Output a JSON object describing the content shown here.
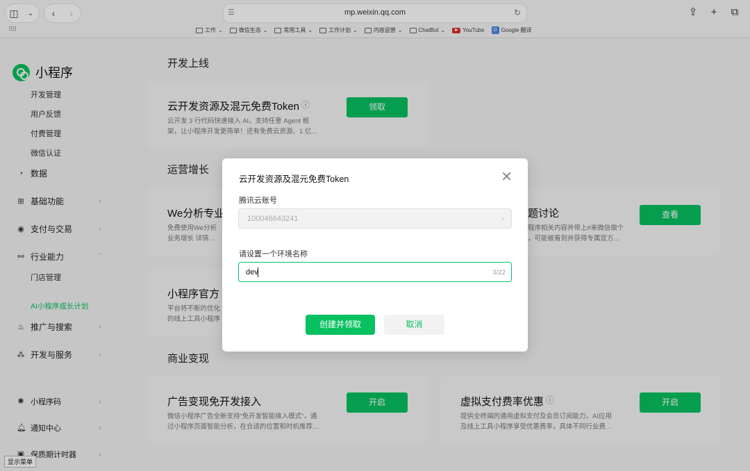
{
  "browser": {
    "url": "mp.weixin.qq.com",
    "bookmarks": [
      {
        "label": "工作"
      },
      {
        "label": "微信生态"
      },
      {
        "label": "常用工具"
      },
      {
        "label": "工作计划"
      },
      {
        "label": "内容运营"
      },
      {
        "label": "ChatBot"
      },
      {
        "label": "YouTube"
      },
      {
        "label": "Google 翻译"
      }
    ]
  },
  "sidebar": {
    "brand": "小程序",
    "sub_items_top": [
      "开发管理",
      "用户反馈",
      "付费管理",
      "微信认证"
    ],
    "groups": [
      {
        "label": "数据"
      },
      {
        "label": "基础功能"
      },
      {
        "label": "支付与交易"
      },
      {
        "label": "行业能力"
      }
    ],
    "sub_items_industry": [
      "门店管理"
    ],
    "active_item": "AI小程序成长计划",
    "groups_bottom": [
      {
        "label": "推广与搜索"
      },
      {
        "label": "开发与服务"
      }
    ],
    "footer_items": [
      {
        "label": "小程序码"
      },
      {
        "label": "通知中心"
      },
      {
        "label": "保质期计时器"
      }
    ],
    "tooltip": "显示菜单"
  },
  "main": {
    "sections": {
      "dev": "开发上线",
      "ops": "运营增长",
      "biz": "商业变现"
    },
    "cards": {
      "cloud": {
        "title": "云开发资源及混元免费Token",
        "desc1": "云开发 3 行代码快速接入 AI，支持任意 Agent 框",
        "desc2": "架，让小程序开发更简单！还有免费云资源、1 亿…",
        "button": "领取"
      },
      "we": {
        "title": "We分析专业",
        "desc1": "免费使用We分析",
        "desc2": "业务增长 详情…"
      },
      "topic": {
        "title": "题讨论",
        "desc1": "程序相关内容并带上#来微信做个",
        "desc2": "，可能被看到并获得专属官方…",
        "button": "查看"
      },
      "official": {
        "title": "小程序官方",
        "desc1": "平台将不断的优化",
        "desc2": "的线上工具小程序"
      },
      "ad": {
        "title": "广告变现免开发接入",
        "desc1": "微信小程序广告全新支持“免开发智能接入模式”，通",
        "desc2": "过小程序页面智能分析，在合适的位置和时机推荐…",
        "button": "开启"
      },
      "vpay": {
        "title": "虚拟支付费率优惠",
        "desc1": "提供全终端的通用虚拟支付及会员订阅能力，AI应用",
        "desc2": "及线上工具小程序享受优惠费率，具体不同行业费…",
        "button": "开启"
      }
    }
  },
  "dialog": {
    "title": "云开发资源及混元免费Token",
    "account_label": "腾讯云账号",
    "account_value": "100046643241",
    "env_label": "请设置一个环境名称",
    "env_value": "dev",
    "env_count": "3/22",
    "confirm": "创建并领取",
    "cancel": "取消"
  }
}
